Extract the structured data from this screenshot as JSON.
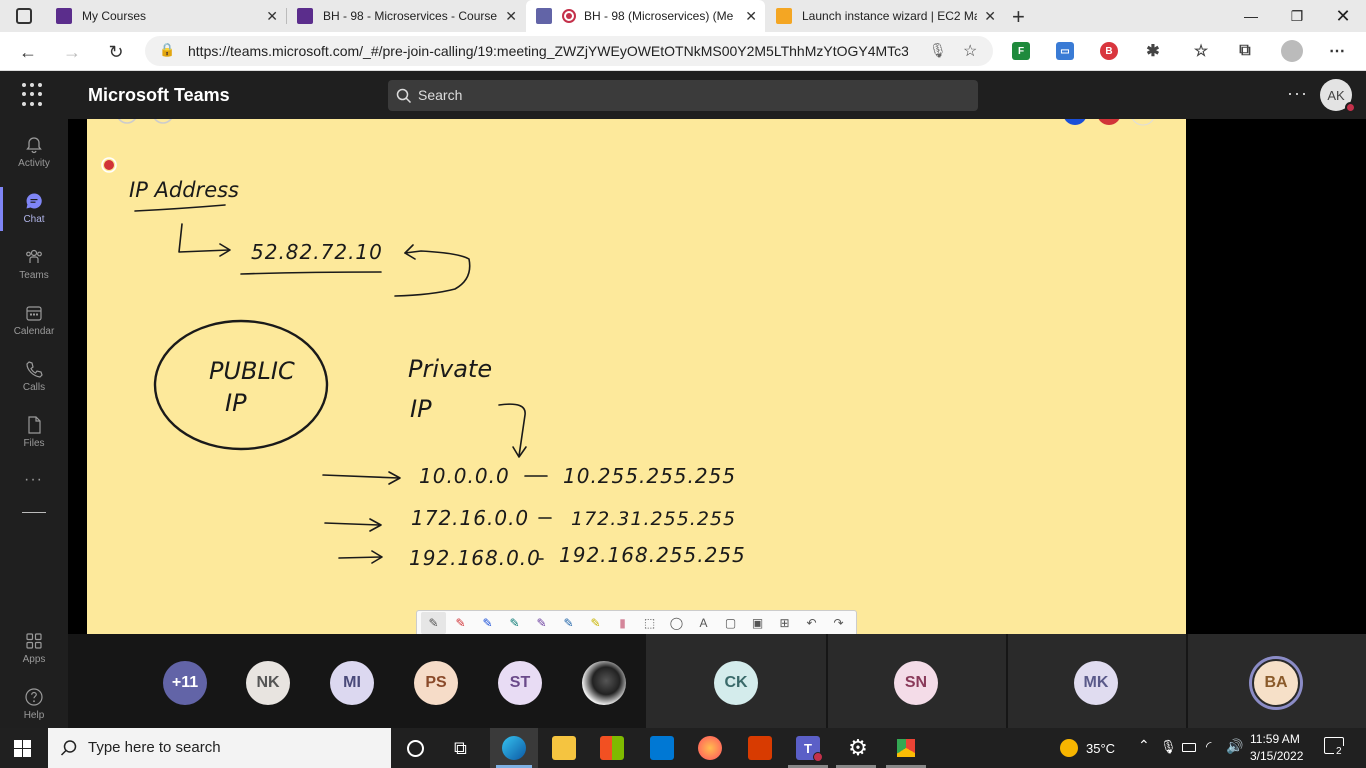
{
  "browser": {
    "tabs": [
      {
        "title": "My Courses",
        "active": false
      },
      {
        "title": "BH - 98 - Microservices - Course",
        "active": false
      },
      {
        "title": "BH - 98 (Microservices) (Me",
        "active": true
      },
      {
        "title": "Launch instance wizard | EC2 Ma",
        "active": false
      }
    ],
    "url": "https://teams.microsoft.com/_#/pre-join-calling/19:meeting_ZWZjYWEyOWEtOTNkMS00Y2M5LThhMzYtOGY4MTc3..."
  },
  "teams": {
    "app_title": "Microsoft Teams",
    "search_placeholder": "Search",
    "user_initials": "AK",
    "rail": [
      {
        "label": "Activity",
        "icon": "bell-icon",
        "active": false
      },
      {
        "label": "Chat",
        "icon": "chat-icon",
        "active": true
      },
      {
        "label": "Teams",
        "icon": "teams-icon",
        "active": false
      },
      {
        "label": "Calendar",
        "icon": "calendar-icon",
        "active": false
      },
      {
        "label": "Calls",
        "icon": "phone-icon",
        "active": false
      },
      {
        "label": "Files",
        "icon": "file-icon",
        "active": false
      }
    ],
    "rail_bottom": [
      {
        "label": "Apps",
        "icon": "apps-icon"
      },
      {
        "label": "Help",
        "icon": "help-icon"
      }
    ]
  },
  "whiteboard": {
    "title": "IP Address",
    "public_ip_example": "52.82.72.10",
    "public_label_1": "PUBLIC",
    "public_label_2": "IP",
    "private_label_1": "Private",
    "private_label_2": "IP",
    "ranges": [
      {
        "start": "10.0.0.0",
        "end": "10.255.255.255"
      },
      {
        "start": "172.16.0.0",
        "end": "172.31.255.255"
      },
      {
        "start": "192.168.0.0",
        "end": "192.168.255.255"
      }
    ],
    "toolbar_tools": [
      "pen-black",
      "pen-red",
      "pen-blue",
      "pen-teal",
      "pen-purple",
      "pen-blue2",
      "highlighter",
      "eraser",
      "lasso",
      "shape",
      "text",
      "note",
      "image",
      "add",
      "undo",
      "redo"
    ]
  },
  "participants": [
    {
      "initials": "+11",
      "bg": "#6264a7",
      "fg": "#ffffff"
    },
    {
      "initials": "NK",
      "bg": "#e8e4e0",
      "fg": "#555555"
    },
    {
      "initials": "MI",
      "bg": "#dcd8f0",
      "fg": "#4a4a7a"
    },
    {
      "initials": "PS",
      "bg": "#f6dcc8",
      "fg": "#8a4a2a"
    },
    {
      "initials": "ST",
      "bg": "#e8dcf4",
      "fg": "#6a4a8a"
    },
    {
      "initials": "",
      "bg": "#888888",
      "fg": "#ffffff"
    },
    {
      "initials": "CK",
      "bg": "#d4ecec",
      "fg": "#3a6a6a"
    },
    {
      "initials": "SN",
      "bg": "#f4dce8",
      "fg": "#8a3a5a"
    },
    {
      "initials": "MK",
      "bg": "#e0dcf0",
      "fg": "#5a5a8a"
    },
    {
      "initials": "BA",
      "bg": "#f6e0c8",
      "fg": "#8a5a2a"
    }
  ],
  "taskbar": {
    "search_placeholder": "Type here to search",
    "weather": "35°C",
    "time": "11:59 AM",
    "date": "3/15/2022",
    "notifications": "2"
  }
}
